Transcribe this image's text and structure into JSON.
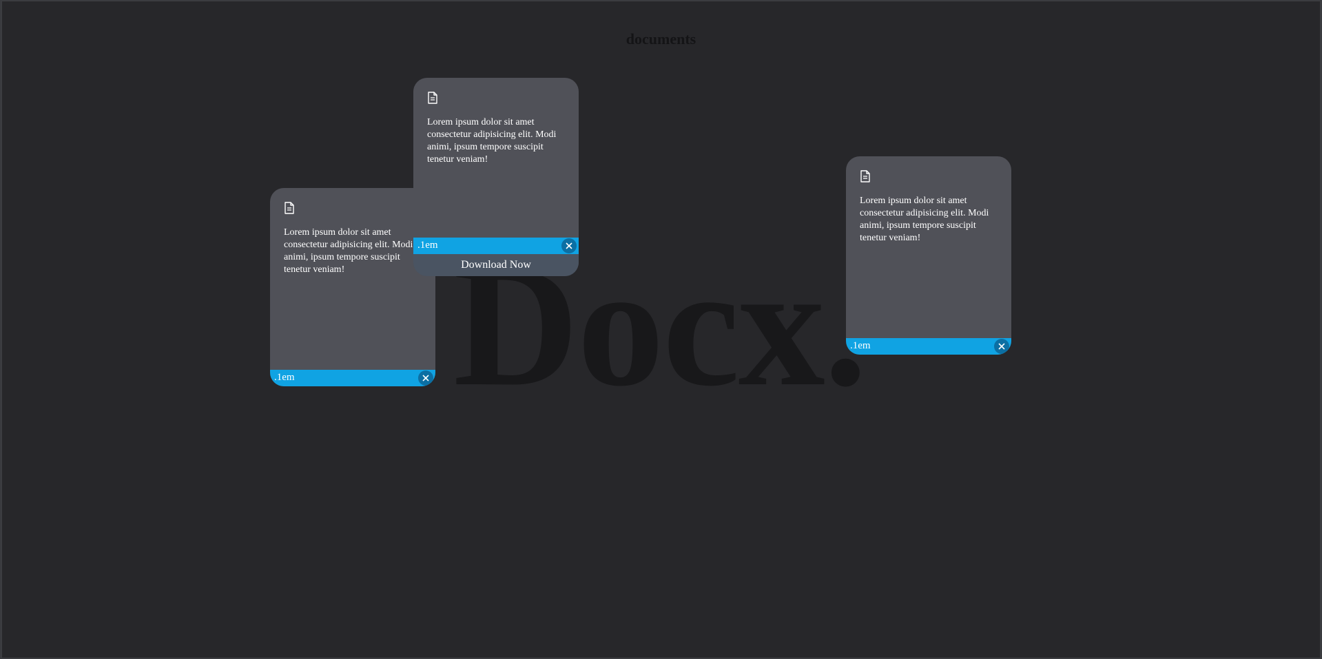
{
  "page": {
    "title": "documents",
    "watermark": "Docx."
  },
  "cards": [
    {
      "icon": "document-icon",
      "text": "Lorem ipsum dolor sit amet consectetur adipisicing elit. Modi animi, ipsum tempore suscipit tenetur veniam!",
      "size_label": ".1em",
      "close_icon": "close-icon"
    },
    {
      "icon": "document-icon",
      "text": "Lorem ipsum dolor sit amet consectetur adipisicing elit. Modi animi, ipsum tempore suscipit tenetur veniam!",
      "size_label": ".1em",
      "close_icon": "close-icon",
      "download_label": "Download Now"
    },
    {
      "icon": "document-icon",
      "text": "Lorem ipsum dolor sit amet consectetur adipisicing elit. Modi animi, ipsum tempore suscipit tenetur veniam!",
      "size_label": ".1em",
      "close_icon": "close-icon"
    }
  ],
  "colors": {
    "background": "#27272a",
    "card": "#505158",
    "accent": "#10a3e3",
    "close_button": "#0c6fa3",
    "download_bar": "#4a5462"
  }
}
